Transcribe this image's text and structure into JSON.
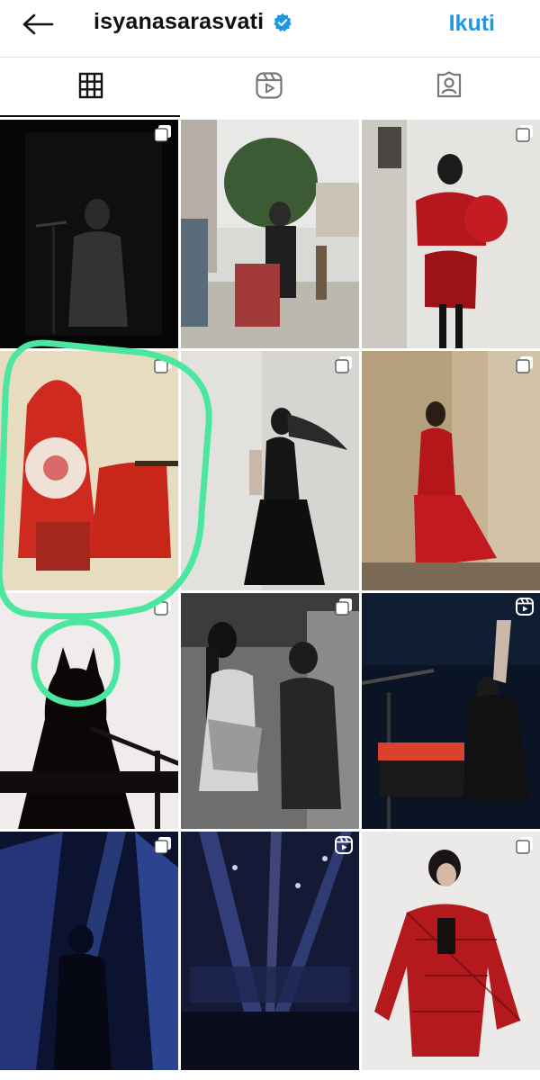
{
  "header": {
    "username": "isyanasarasvati",
    "follow_label": "Ikuti",
    "back_icon": "arrow-left-icon",
    "verified_icon": "verified-badge-icon",
    "accent_color": "#1a9ae6"
  },
  "tabs": [
    {
      "name": "posts",
      "icon": "grid-icon",
      "active": true
    },
    {
      "name": "reels",
      "icon": "reels-icon",
      "active": false
    },
    {
      "name": "tagged",
      "icon": "tagged-person-icon",
      "active": false
    }
  ],
  "posts": [
    {
      "badge": "multi-photo-icon"
    },
    {
      "badge": ""
    },
    {
      "badge": "multi-photo-icon"
    },
    {
      "badge": "multi-photo-icon"
    },
    {
      "badge": "multi-photo-icon"
    },
    {
      "badge": "multi-photo-icon"
    },
    {
      "badge": "multi-photo-icon"
    },
    {
      "badge": "multi-photo-icon"
    },
    {
      "badge": "reels-icon"
    },
    {
      "badge": "multi-photo-icon"
    },
    {
      "badge": "reels-icon"
    },
    {
      "badge": "multi-photo-icon"
    }
  ],
  "annotation_color": "#4be6a0"
}
